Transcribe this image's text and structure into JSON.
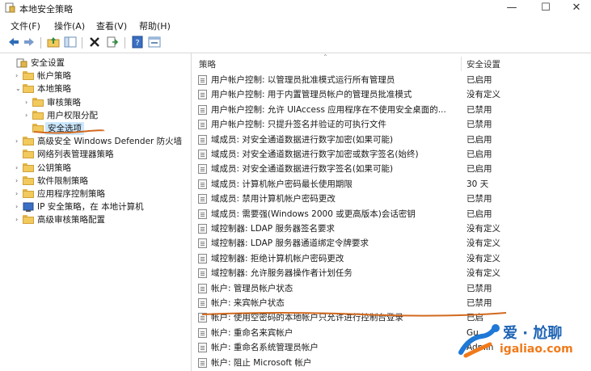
{
  "window": {
    "title": "本地安全策略",
    "minimize": "—",
    "maximize": "☐",
    "close": "✕"
  },
  "menu": [
    "文件(F)",
    "操作(A)",
    "查看(V)",
    "帮助(H)"
  ],
  "toolbar_icons": [
    "back-arrow-icon",
    "forward-arrow-icon",
    "up-folder-icon",
    "show-tree-icon",
    "delete-icon",
    "export-icon",
    "help-icon",
    "properties-icon"
  ],
  "tree": [
    {
      "label": "安全设置",
      "toggle": "",
      "icon": "security-icon"
    },
    {
      "label": "帐户策略",
      "toggle": "›",
      "icon": "folder-icon"
    },
    {
      "label": "本地策略",
      "toggle": "⌄",
      "icon": "folder-icon"
    },
    {
      "label": "审核策略",
      "toggle": "›",
      "icon": "folder-icon"
    },
    {
      "label": "用户权限分配",
      "toggle": "›",
      "icon": "folder-icon"
    },
    {
      "label": "安全选项",
      "toggle": "",
      "icon": "folder-icon",
      "selected": true
    },
    {
      "label": "高级安全 Windows Defender 防火墙",
      "toggle": "›",
      "icon": "folder-icon"
    },
    {
      "label": "网络列表管理器策略",
      "toggle": "",
      "icon": "folder-icon"
    },
    {
      "label": "公钥策略",
      "toggle": "›",
      "icon": "folder-icon"
    },
    {
      "label": "软件限制策略",
      "toggle": "›",
      "icon": "folder-icon"
    },
    {
      "label": "应用程序控制策略",
      "toggle": "›",
      "icon": "folder-icon"
    },
    {
      "label": "IP 安全策略，在 本地计算机",
      "toggle": "›",
      "icon": "ip-security-icon"
    },
    {
      "label": "高级审核策略配置",
      "toggle": "›",
      "icon": "folder-icon"
    }
  ],
  "columns": {
    "policy": "策略",
    "setting": "安全设置"
  },
  "policies": [
    {
      "name": "用户帐户控制: 以管理员批准模式运行所有管理员",
      "value": "已启用"
    },
    {
      "name": "用户帐户控制: 用于内置管理员帐户的管理员批准模式",
      "value": "没有定义"
    },
    {
      "name": "用户帐户控制: 允许 UIAccess 应用程序在不使用安全桌面的...",
      "value": "已禁用"
    },
    {
      "name": "用户帐户控制: 只提升签名并验证的可执行文件",
      "value": "已禁用"
    },
    {
      "name": "域成员: 对安全通道数据进行数字加密(如果可能)",
      "value": "已启用"
    },
    {
      "name": "域成员: 对安全通道数据进行数字加密或数字签名(始终)",
      "value": "已启用"
    },
    {
      "name": "域成员: 对安全通道数据进行数字签名(如果可能)",
      "value": "已启用"
    },
    {
      "name": "域成员: 计算机帐户密码最长使用期限",
      "value": "30 天"
    },
    {
      "name": "域成员: 禁用计算机帐户密码更改",
      "value": "已禁用"
    },
    {
      "name": "域成员: 需要强(Windows 2000 或更高版本)会话密钥",
      "value": "已启用"
    },
    {
      "name": "域控制器: LDAP 服务器签名要求",
      "value": "没有定义"
    },
    {
      "name": "域控制器: LDAP 服务器通道绑定令牌要求",
      "value": "没有定义"
    },
    {
      "name": "域控制器: 拒绝计算机帐户密码更改",
      "value": "没有定义"
    },
    {
      "name": "域控制器: 允许服务器操作者计划任务",
      "value": "没有定义"
    },
    {
      "name": "帐户: 管理员帐户状态",
      "value": "已禁用"
    },
    {
      "name": "帐户: 来宾帐户状态",
      "value": "已禁用"
    },
    {
      "name": "帐户: 使用空密码的本地帐户只允许进行控制台登录",
      "value": "已启"
    },
    {
      "name": "帐户: 重命名来宾帐户",
      "value": "Gu"
    },
    {
      "name": "帐户: 重命名系统管理员帐户",
      "value": "Admin"
    },
    {
      "name": "帐户: 阻止 Microsoft 帐户",
      "value": ""
    }
  ],
  "watermark": {
    "brand": "爱 · 尬聊",
    "url": "igaliao.com"
  },
  "colors": {
    "selection": "#cce8ff",
    "annotation": "#d2691e",
    "folder": "#f2c95c"
  }
}
